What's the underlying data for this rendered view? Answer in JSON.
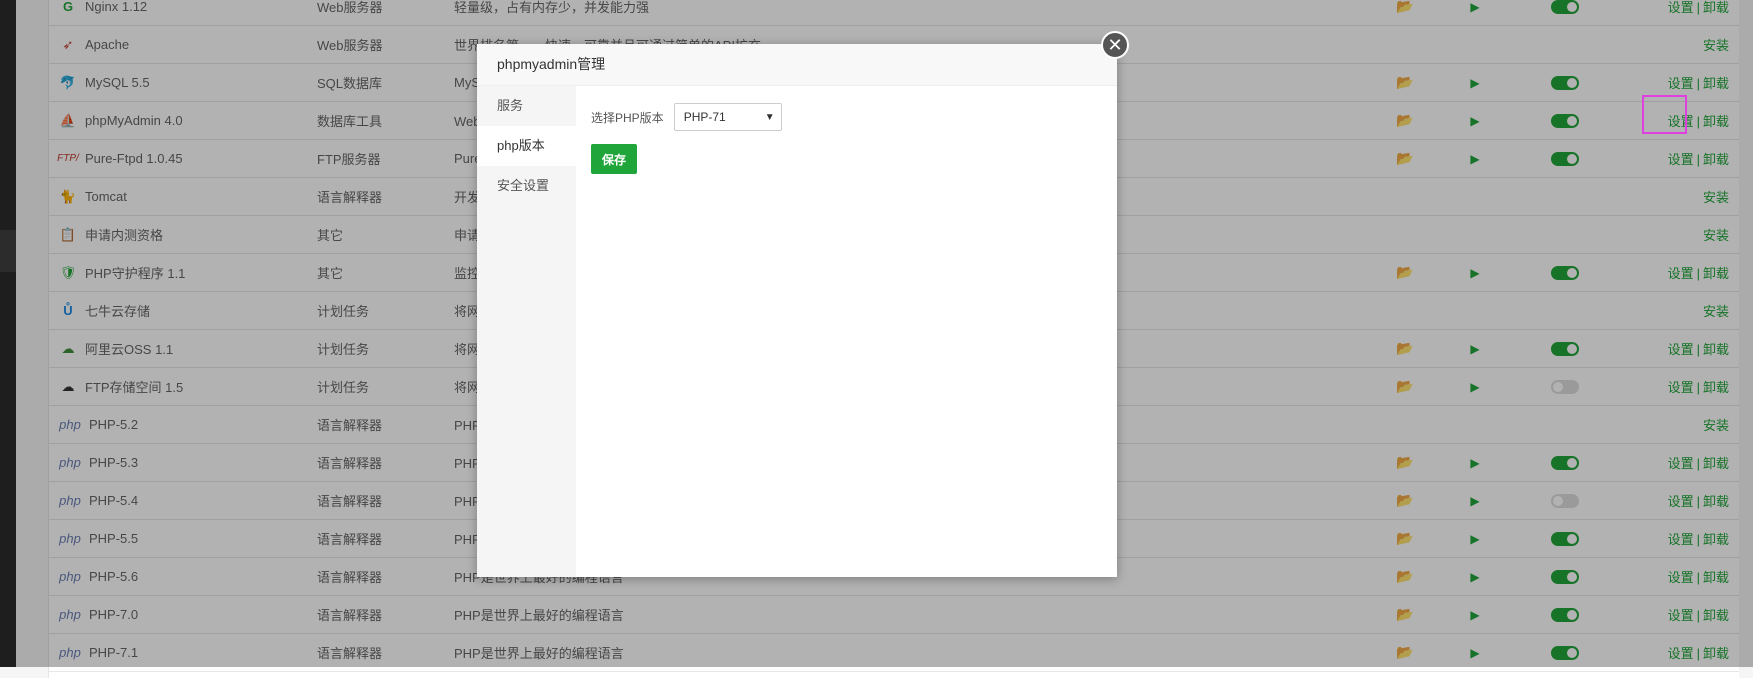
{
  "colors": {
    "accent": "#20a53a",
    "folder": "#e6b54a",
    "highlight": "#e040e0"
  },
  "rows": [
    {
      "name": "Nginx 1.12",
      "type": "Web服务器",
      "desc": "轻量级，占有内存少，并发能力强",
      "icon": "nginx-icon",
      "folder": true,
      "play": true,
      "toggle": "on",
      "ops": "setup-uninstall"
    },
    {
      "name": "Apache",
      "type": "Web服务器",
      "desc": "世界排名第一，快速、可靠并且可通过简单的API扩充",
      "icon": "apache-feather-icon",
      "folder": false,
      "play": false,
      "toggle": "none",
      "ops": "install"
    },
    {
      "name": "MySQL 5.5",
      "type": "SQL数据库",
      "desc": "MySQ",
      "icon": "mysql-dolphin-icon",
      "folder": true,
      "play": true,
      "toggle": "on",
      "ops": "setup-uninstall"
    },
    {
      "name": "phpMyAdmin 4.0",
      "type": "数据库工具",
      "desc": "Web端",
      "icon": "phpmyadmin-sail-icon",
      "folder": true,
      "play": true,
      "toggle": "on",
      "ops": "setup-uninstall"
    },
    {
      "name": "Pure-Ftpd 1.0.45",
      "type": "FTP服务器",
      "desc": "PureF",
      "icon": "ftp-icon",
      "folder": true,
      "play": true,
      "toggle": "on",
      "ops": "setup-uninstall"
    },
    {
      "name": "Tomcat",
      "type": "语言解释器",
      "desc": "开发和",
      "icon": "tomcat-cat-icon",
      "folder": false,
      "play": false,
      "toggle": "none",
      "ops": "install"
    },
    {
      "name": "申请内测资格",
      "type": "其它",
      "desc": "申请内",
      "icon": "clipboard-icon",
      "folder": false,
      "play": false,
      "toggle": "none",
      "ops": "install"
    },
    {
      "name": "PHP守护程序 1.1",
      "type": "其它",
      "desc": "监控P",
      "icon": "php-shield-icon",
      "folder": true,
      "play": true,
      "toggle": "on",
      "ops": "setup-uninstall"
    },
    {
      "name": "七牛云存储",
      "type": "计划任务",
      "desc": "将网站",
      "icon": "qiniu-bull-icon",
      "folder": false,
      "play": false,
      "toggle": "none",
      "ops": "install"
    },
    {
      "name": "阿里云OSS 1.1",
      "type": "计划任务",
      "desc": "将网站",
      "icon": "aliyun-cloud-icon",
      "folder": true,
      "play": true,
      "toggle": "on",
      "ops": "setup-uninstall"
    },
    {
      "name": "FTP存储空间 1.5",
      "type": "计划任务",
      "desc": "将网站",
      "icon": "ftp-cloud-icon",
      "folder": true,
      "play": true,
      "toggle": "off",
      "ops": "setup-uninstall"
    },
    {
      "name": "PHP-5.2",
      "type": "语言解释器",
      "desc": "PHP是",
      "icon": "php-icon",
      "folder": false,
      "play": false,
      "toggle": "none",
      "ops": "install"
    },
    {
      "name": "PHP-5.3",
      "type": "语言解释器",
      "desc": "PHP是",
      "icon": "php-icon",
      "folder": true,
      "play": true,
      "toggle": "on",
      "ops": "setup-uninstall"
    },
    {
      "name": "PHP-5.4",
      "type": "语言解释器",
      "desc": "PHP是",
      "icon": "php-icon",
      "folder": true,
      "play": true,
      "toggle": "off",
      "ops": "setup-uninstall"
    },
    {
      "name": "PHP-5.5",
      "type": "语言解释器",
      "desc": "PHP是",
      "icon": "php-icon",
      "folder": true,
      "play": true,
      "toggle": "on",
      "ops": "setup-uninstall"
    },
    {
      "name": "PHP-5.6",
      "type": "语言解释器",
      "desc": "PHP是世界上最好的编程语言",
      "icon": "php-icon",
      "folder": true,
      "play": true,
      "toggle": "on",
      "ops": "setup-uninstall"
    },
    {
      "name": "PHP-7.0",
      "type": "语言解释器",
      "desc": "PHP是世界上最好的编程语言",
      "icon": "php-icon",
      "folder": true,
      "play": true,
      "toggle": "on",
      "ops": "setup-uninstall"
    },
    {
      "name": "PHP-7.1",
      "type": "语言解释器",
      "desc": "PHP是世界上最好的编程语言",
      "icon": "php-icon",
      "folder": true,
      "play": true,
      "toggle": "on",
      "ops": "setup-uninstall"
    }
  ],
  "ops_labels": {
    "setup": "设置",
    "sep": "|",
    "uninstall": "卸载",
    "install": "安装"
  },
  "php_icon_text": "php",
  "modal": {
    "title": "phpmyadmin管理",
    "close_glyph": "✕",
    "nav": [
      {
        "label": "服务",
        "active": false
      },
      {
        "label": "php版本",
        "active": true
      },
      {
        "label": "安全设置",
        "active": false
      }
    ],
    "field_label": "选择PHP版本",
    "selected": "PHP-71",
    "save_label": "保存"
  }
}
